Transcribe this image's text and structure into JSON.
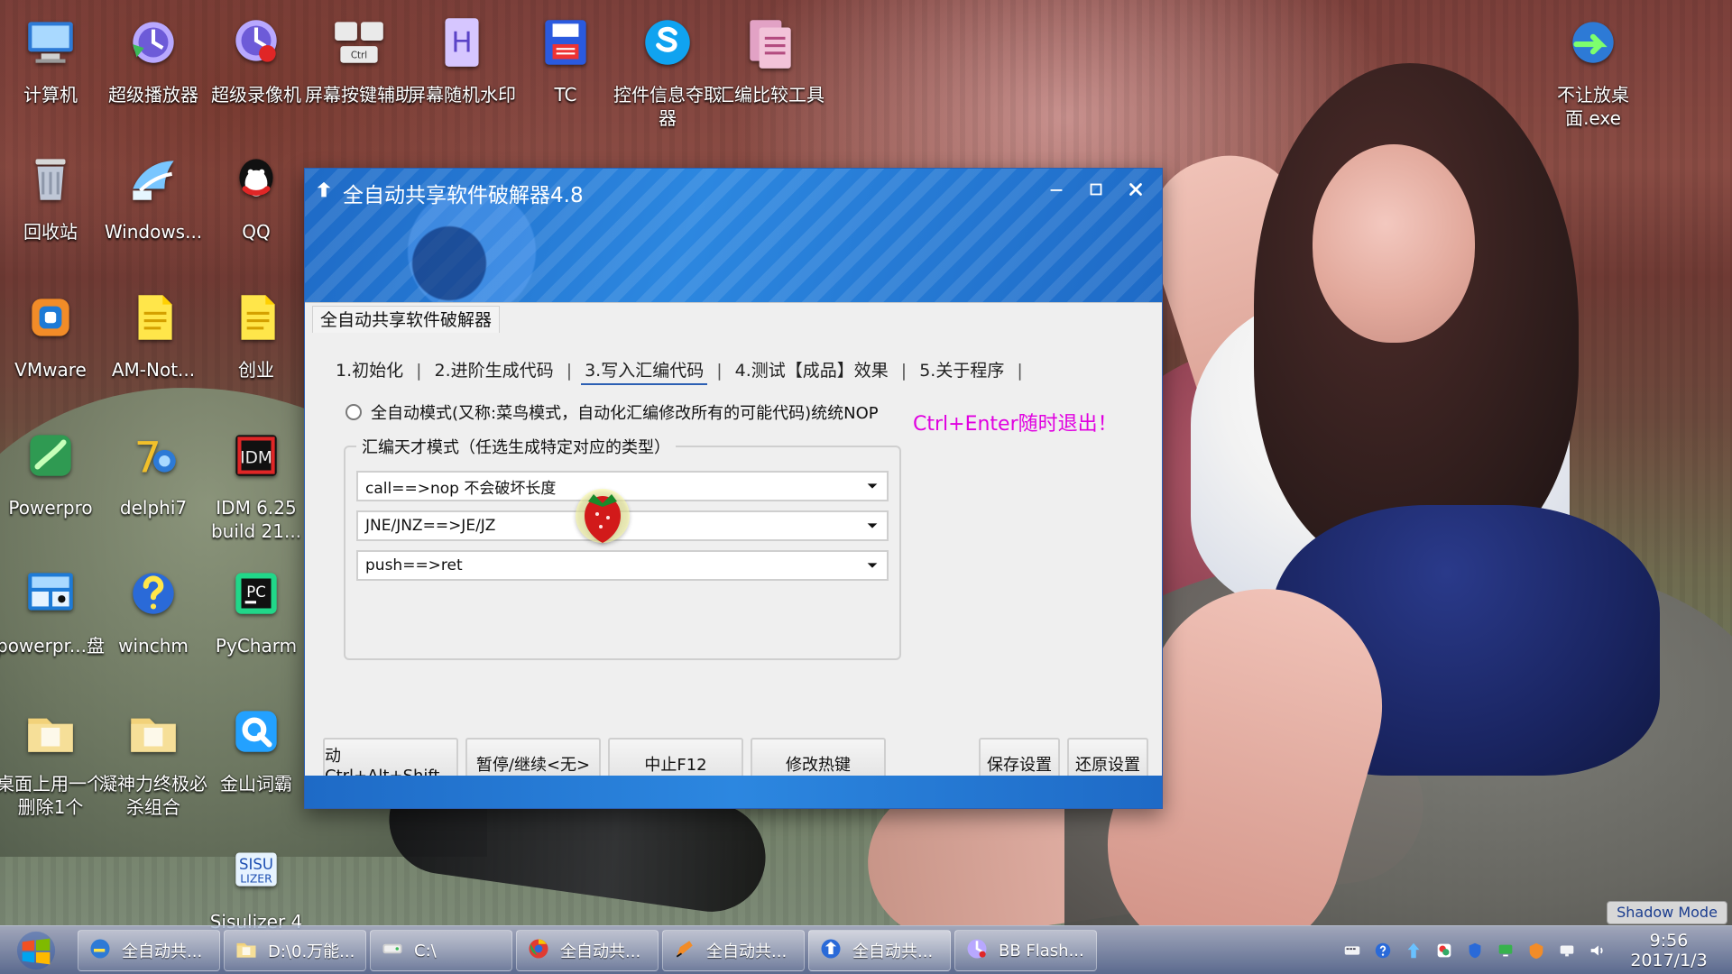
{
  "desktop": {
    "icons": [
      {
        "label": "计算机",
        "icon": "computer"
      },
      {
        "label": "超级播放器",
        "icon": "player"
      },
      {
        "label": "超级录像机",
        "icon": "recorder"
      },
      {
        "label": "屏幕按键辅助",
        "icon": "keyboard"
      },
      {
        "label": "屏幕随机水印",
        "icon": "watermark"
      },
      {
        "label": "TC",
        "icon": "save-disk"
      },
      {
        "label": "控件信息夺取器",
        "icon": "skype-like"
      },
      {
        "label": "汇编比较工具",
        "icon": "compare"
      },
      {
        "label": "不让放桌面.exe",
        "icon": "ie-arrow"
      },
      {
        "label": "回收站",
        "icon": "recycle"
      },
      {
        "label": "Windows...",
        "icon": "windows-live"
      },
      {
        "label": "QQ",
        "icon": "qq"
      },
      {
        "label": "VMware",
        "icon": "vmware"
      },
      {
        "label": "AM-Not...",
        "icon": "note"
      },
      {
        "label": "创业",
        "icon": "note"
      },
      {
        "label": "Powerpro",
        "icon": "powerpro"
      },
      {
        "label": "delphi7",
        "icon": "delphi"
      },
      {
        "label": "IDM 6.25 build 21...",
        "icon": "idm"
      },
      {
        "label": "powerpr...盘",
        "icon": "powerpro-panel"
      },
      {
        "label": "winchm",
        "icon": "help"
      },
      {
        "label": "PyCharm",
        "icon": "pycharm"
      },
      {
        "label": "桌面上用一个删除1个",
        "icon": "folder"
      },
      {
        "label": "凝神力终极必杀组合",
        "icon": "folder"
      },
      {
        "label": "金山词霸",
        "icon": "dict"
      },
      {
        "label": "Sisulizer 4",
        "icon": "sisulizer"
      }
    ]
  },
  "window": {
    "title": "全自动共享软件破解器4.8",
    "tab_header": "全自动共享软件破解器",
    "tabs": [
      "1.初始化",
      "2.进阶生成代码",
      "3.写入汇编代码",
      "4.测试【成品】效果",
      "5.关于程序"
    ],
    "active_tab": 2,
    "radio_label": "全自动模式(又称:菜鸟模式，自动化汇编修改所有的可能代码)统统NOP",
    "hint": "Ctrl+Enter随时退出！",
    "group_label": "汇编天才模式（任选生成特定对应的类型）",
    "dropdowns": [
      "call==>nop  不会破坏长度",
      "JNE/JNZ==>JE/JZ",
      "push==>ret"
    ],
    "buttons": [
      "动Ctrl+Alt+Shift-",
      "暂停/继续<无>",
      "中止F12",
      "修改热键",
      "保存设置",
      "还原设置"
    ]
  },
  "taskbar": {
    "items": [
      {
        "label": "全自动共...",
        "icon": "ie-app"
      },
      {
        "label": "D:\\0.万能...",
        "icon": "folder"
      },
      {
        "label": "C:\\",
        "icon": "drive"
      },
      {
        "label": "全自动共...",
        "icon": "chrome"
      },
      {
        "label": "全自动共...",
        "icon": "pen"
      },
      {
        "label": "全自动共...",
        "icon": "app"
      },
      {
        "label": "BB Flash...",
        "icon": "bbflash"
      }
    ],
    "clock": {
      "time": "9:56",
      "date": "2017/1/3"
    }
  },
  "shadow_mode": "Shadow Mode"
}
